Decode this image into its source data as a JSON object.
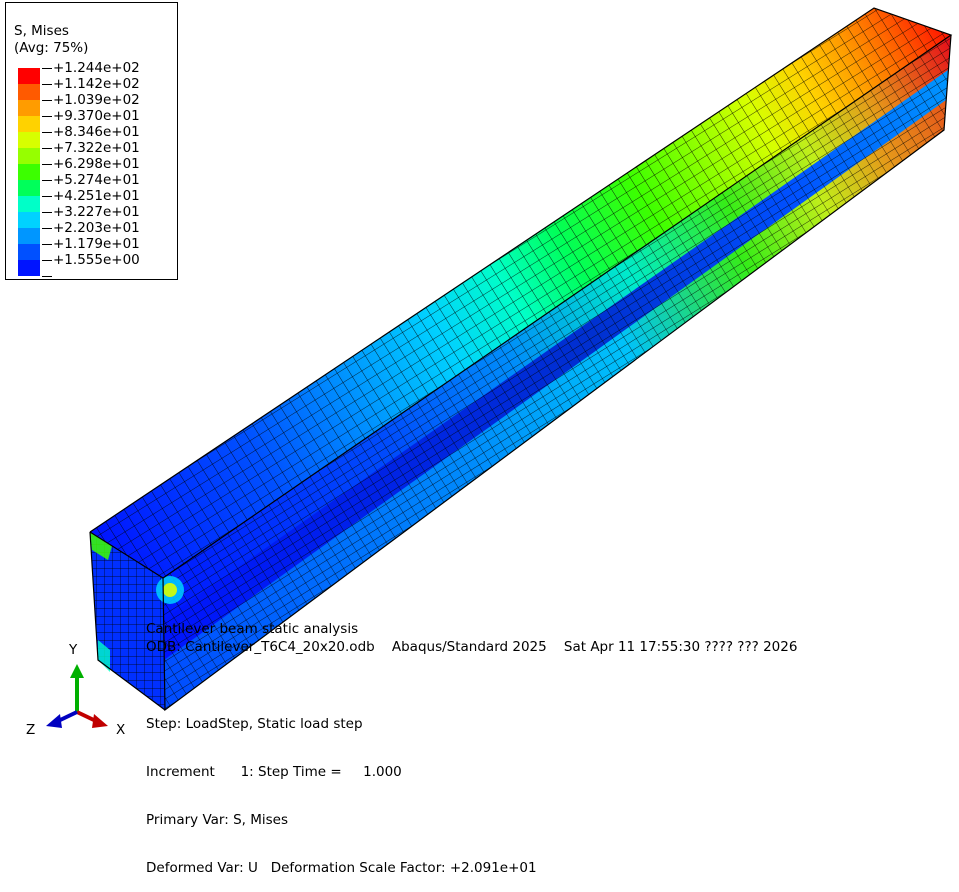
{
  "legend": {
    "title": "S, Mises",
    "subtitle": "(Avg: 75%)",
    "entries": [
      {
        "label": "+1.244e+02",
        "color": "#ff0000"
      },
      {
        "label": "+1.142e+02",
        "color": "#ff5a00"
      },
      {
        "label": "+1.039e+02",
        "color": "#ff9c00"
      },
      {
        "label": "+9.370e+01",
        "color": "#ffd200"
      },
      {
        "label": "+8.346e+01",
        "color": "#d7ff00"
      },
      {
        "label": "+7.322e+01",
        "color": "#96ff00"
      },
      {
        "label": "+6.298e+01",
        "color": "#3cff00"
      },
      {
        "label": "+5.274e+01",
        "color": "#00ff5a"
      },
      {
        "label": "+4.251e+01",
        "color": "#00ffc8"
      },
      {
        "label": "+3.227e+01",
        "color": "#00d2ff"
      },
      {
        "label": "+2.203e+01",
        "color": "#0096ff"
      },
      {
        "label": "+1.179e+01",
        "color": "#0050ff"
      },
      {
        "label": "+1.555e+00",
        "color": "#0014ff"
      }
    ]
  },
  "model": {
    "contour_palette": [
      "#0014ff",
      "#0050ff",
      "#0096ff",
      "#00d2ff",
      "#00ffc8",
      "#00ff5a",
      "#3cff00",
      "#96ff00",
      "#d7ff00",
      "#ffd200",
      "#ff9c00",
      "#ff5a00",
      "#ff0000"
    ]
  },
  "info": {
    "line1": "Cantilever beam static analysis",
    "line2": "ODB: Cantilever_T6C4_20x20.odb    Abaqus/Standard 2025    Sat Apr 11 17:55:30 ???? ??? 2026",
    "step": "Step: LoadStep, Static load step",
    "increment": "Increment      1: Step Time =     1.000",
    "primary": "Primary Var: S, Mises",
    "deformed": "Deformed Var: U   Deformation Scale Factor: +2.091e+01"
  },
  "triad": {
    "x": "X",
    "y": "Y",
    "z": "Z"
  }
}
